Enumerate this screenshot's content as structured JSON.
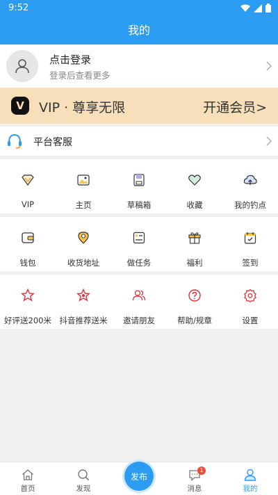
{
  "status_bar": {
    "time": "9:52"
  },
  "header": {
    "title": "我的"
  },
  "login": {
    "title": "点击登录",
    "subtitle": "登录后查看更多"
  },
  "vip": {
    "badge": "V",
    "text": "VIP · 尊享无限",
    "action": "开通会员>"
  },
  "service": {
    "label": "平台客服"
  },
  "grid_row1": [
    {
      "label": "VIP",
      "icon": "vip-icon"
    },
    {
      "label": "主页",
      "icon": "image-icon"
    },
    {
      "label": "草稿箱",
      "icon": "drafts-icon"
    },
    {
      "label": "收藏",
      "icon": "heart-icon"
    },
    {
      "label": "我的钓点",
      "icon": "cloud-upload-icon"
    }
  ],
  "grid_row2": [
    {
      "label": "钱包",
      "icon": "wallet-icon"
    },
    {
      "label": "收货地址",
      "icon": "location-pin-icon"
    },
    {
      "label": "做任务",
      "icon": "task-list-icon"
    },
    {
      "label": "福利",
      "icon": "gift-icon"
    },
    {
      "label": "签到",
      "icon": "calendar-check-icon"
    }
  ],
  "grid_row3": [
    {
      "label": "好评送200米",
      "icon": "star-icon"
    },
    {
      "label": "抖音推荐送米",
      "icon": "star-badge-icon"
    },
    {
      "label": "邀请朋友",
      "icon": "friends-icon"
    },
    {
      "label": "帮助/规章",
      "icon": "help-icon"
    },
    {
      "label": "设置",
      "icon": "gear-icon"
    }
  ],
  "tabbar": {
    "home": "首页",
    "discover": "发现",
    "publish": "发布",
    "messages": "消息",
    "messages_badge": "1",
    "mine": "我的"
  },
  "colors": {
    "primary": "#2c9cf2",
    "vip_bg": "#f6dfb9",
    "accent_red": "#d9303a",
    "badge_red": "#f04a3a"
  }
}
